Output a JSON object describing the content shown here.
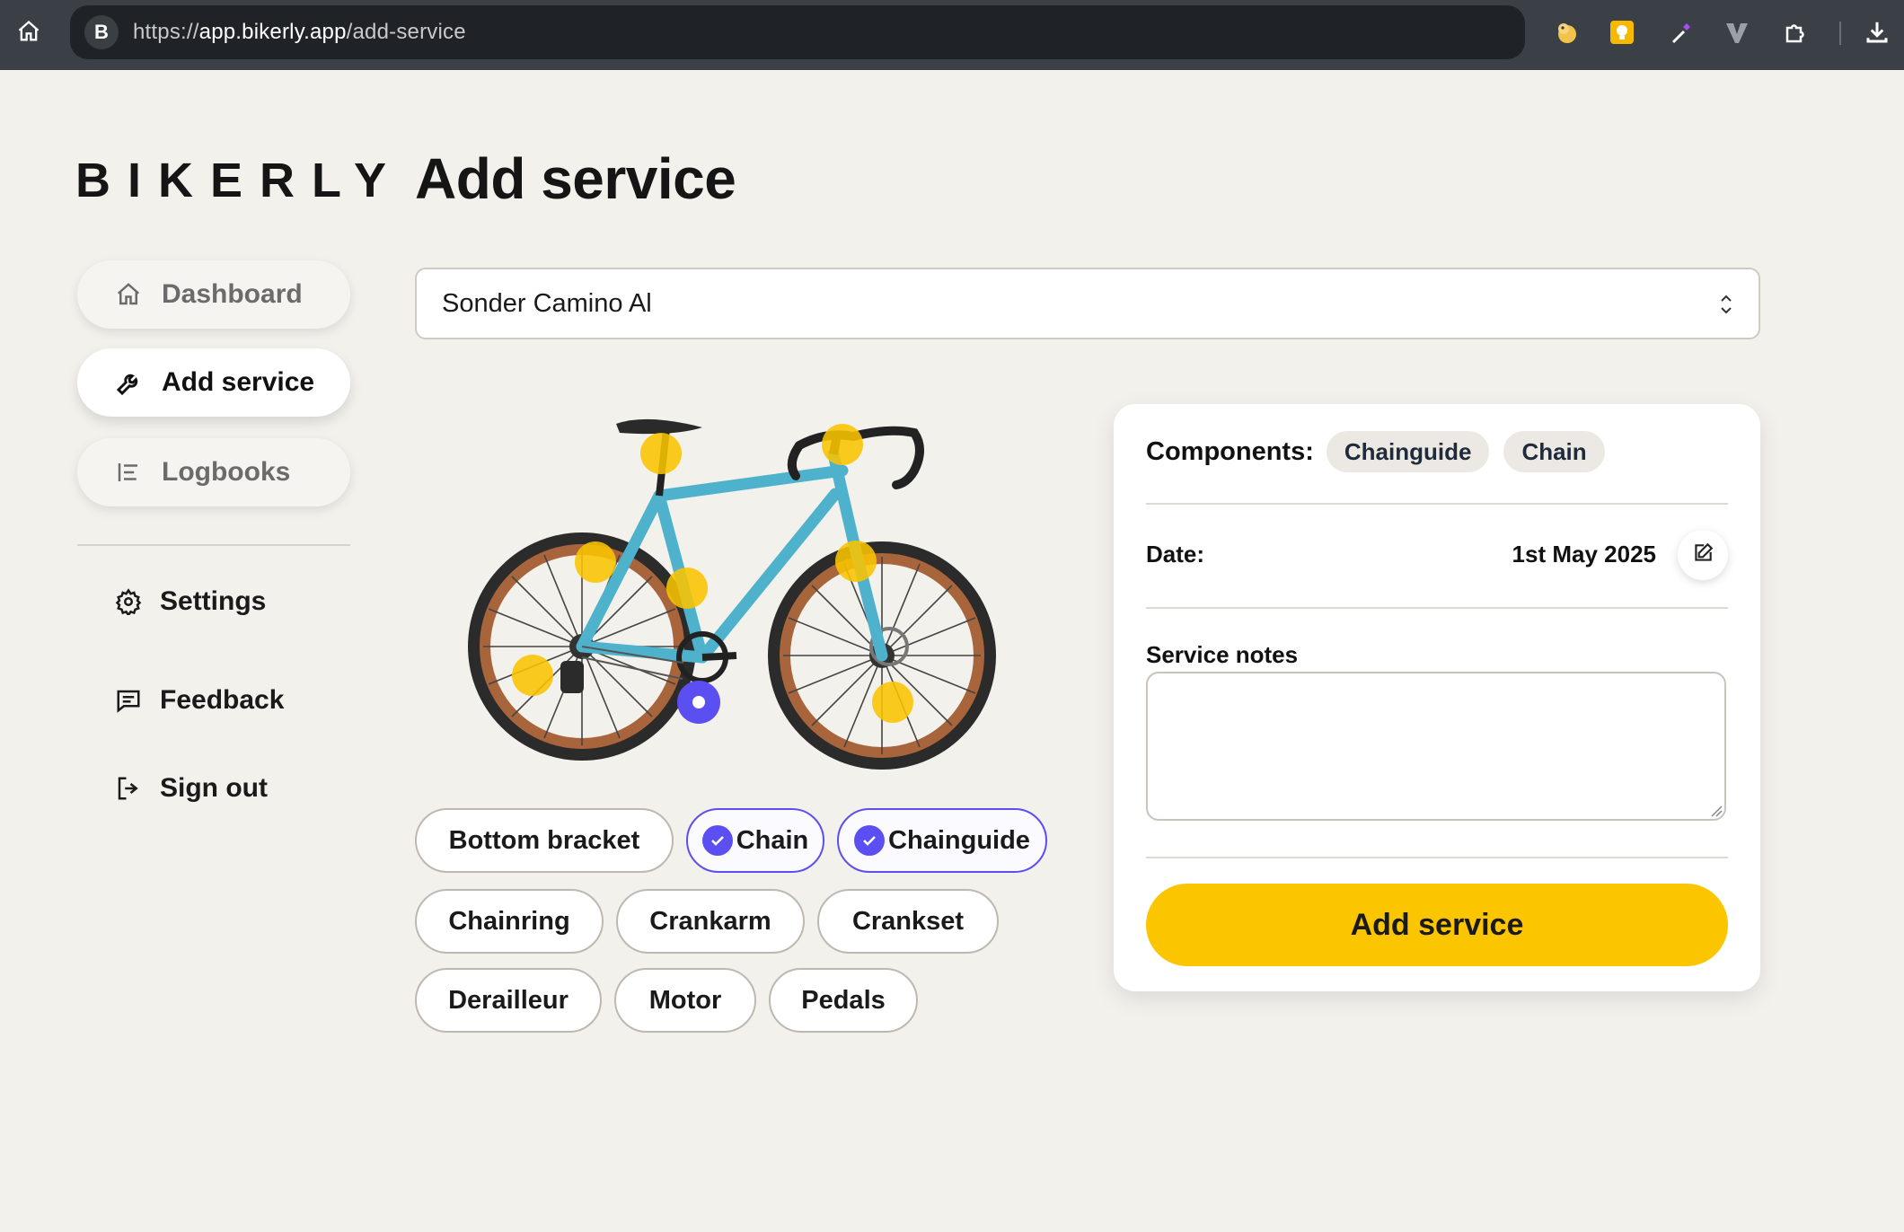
{
  "browser": {
    "url_scheme": "https://",
    "url_host": "app.bikerly.app",
    "url_path": "/add-service",
    "favicon_letter": "B"
  },
  "sidebar": {
    "logo": "BIKERLY",
    "nav": [
      {
        "label": "Dashboard",
        "icon": "home-icon"
      },
      {
        "label": "Add service",
        "icon": "wrench-icon"
      },
      {
        "label": "Logbooks",
        "icon": "list-icon"
      }
    ],
    "links": [
      {
        "label": "Settings",
        "icon": "gear-icon"
      },
      {
        "label": "Feedback",
        "icon": "message-icon"
      },
      {
        "label": "Sign out",
        "icon": "logout-icon"
      }
    ]
  },
  "main": {
    "title": "Add service",
    "bike_select": {
      "value": "Sonder Camino Al"
    },
    "components": [
      {
        "label": "Bottom bracket",
        "selected": false
      },
      {
        "label": "Chain",
        "selected": true
      },
      {
        "label": "Chainguide",
        "selected": true
      },
      {
        "label": "Chainring",
        "selected": false
      },
      {
        "label": "Crankarm",
        "selected": false
      },
      {
        "label": "Crankset",
        "selected": false
      },
      {
        "label": "Derailleur",
        "selected": false
      },
      {
        "label": "Motor",
        "selected": false
      },
      {
        "label": "Pedals",
        "selected": false
      }
    ]
  },
  "card": {
    "components_label": "Components:",
    "tags": [
      "Chainguide",
      "Chain"
    ],
    "date_label": "Date:",
    "date_value": "1st May 2025",
    "notes_label": "Service notes",
    "notes_value": "",
    "submit_label": "Add service"
  },
  "colors": {
    "accent": "#5b4ff2",
    "primary_button": "#fbc500",
    "background": "#f3f1ec"
  }
}
